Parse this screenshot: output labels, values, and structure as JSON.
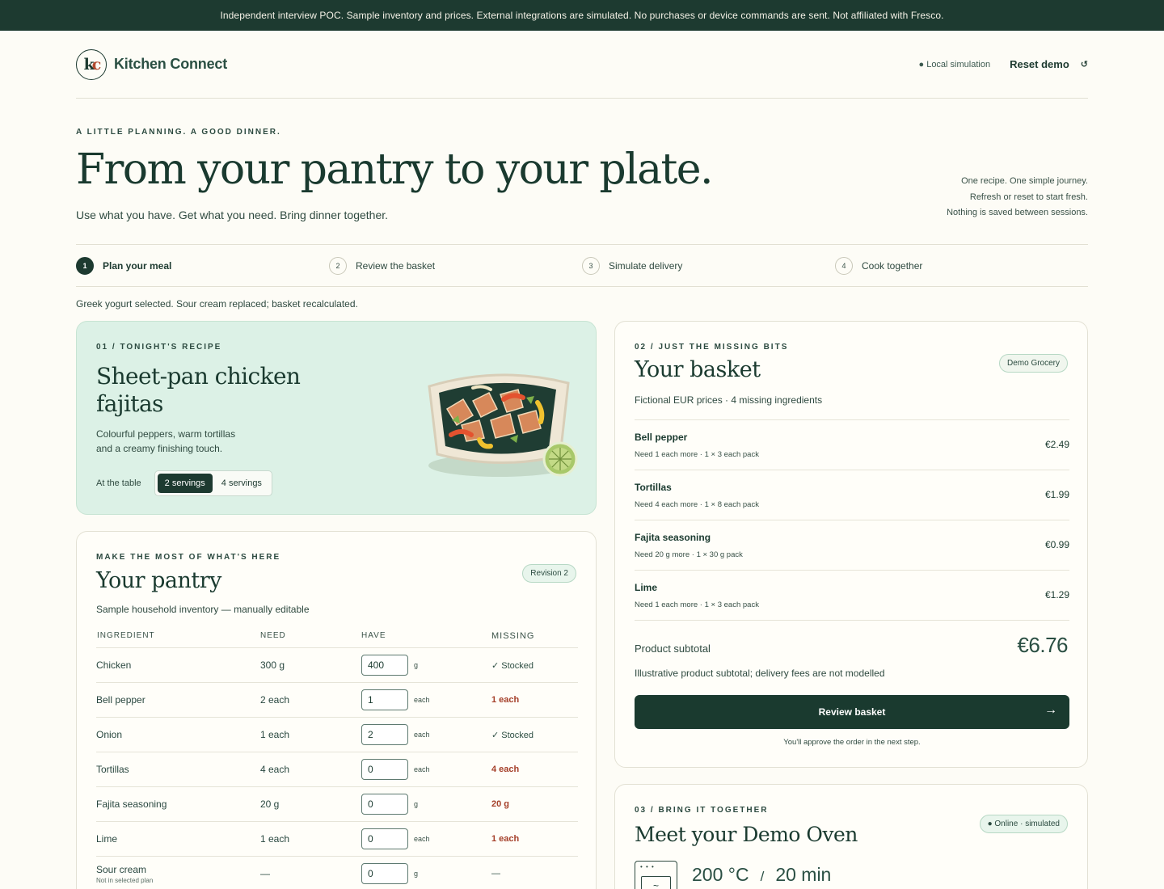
{
  "banner": "Independent interview POC. Sample inventory and prices. External integrations are simulated. No purchases or device commands are sent. Not affiliated with Fresco.",
  "header": {
    "brand": "Kitchen Connect",
    "local_sim": "● Local simulation",
    "reset_label": "Reset demo",
    "reset_icon": "↺"
  },
  "hero": {
    "eyebrow": "A LITTLE PLANNING. A GOOD DINNER.",
    "title": "From your pantry to your plate.",
    "subtitle": "Use what you have. Get what you need. Bring dinner together.",
    "notes": [
      "One recipe. One simple journey.",
      "Refresh or reset to start fresh.",
      "Nothing is saved between sessions."
    ]
  },
  "steps": [
    {
      "num": "1",
      "label": "Plan your meal",
      "active": true
    },
    {
      "num": "2",
      "label": "Review the basket",
      "active": false
    },
    {
      "num": "3",
      "label": "Simulate delivery",
      "active": false
    },
    {
      "num": "4",
      "label": "Cook together",
      "active": false
    }
  ],
  "status": "Greek yogurt selected. Sour cream replaced; basket recalculated.",
  "recipe": {
    "eyebrow": "01 / TONIGHT'S RECIPE",
    "title": "Sheet-pan chicken fajitas",
    "description": "Colourful peppers, warm tortillas and a creamy finishing touch.",
    "table_label": "At the table",
    "servings": [
      "2 servings",
      "4 servings"
    ],
    "selected_serving": "2 servings"
  },
  "pantry": {
    "eyebrow": "MAKE THE MOST OF WHAT'S HERE",
    "title": "Your pantry",
    "subtitle": "Sample household inventory — manually editable",
    "revision": "Revision 2",
    "columns": [
      "INGREDIENT",
      "NEED",
      "HAVE",
      "MISSING"
    ],
    "rows": [
      {
        "ingredient": "Chicken",
        "need": "300 g",
        "have": "400",
        "unit": "g",
        "missing": "✓ Stocked",
        "status": "stocked"
      },
      {
        "ingredient": "Bell pepper",
        "need": "2 each",
        "have": "1",
        "unit": "each",
        "missing": "1 each",
        "status": "missing"
      },
      {
        "ingredient": "Onion",
        "need": "1 each",
        "have": "2",
        "unit": "each",
        "missing": "✓ Stocked",
        "status": "stocked"
      },
      {
        "ingredient": "Tortillas",
        "need": "4 each",
        "have": "0",
        "unit": "each",
        "missing": "4 each",
        "status": "missing"
      },
      {
        "ingredient": "Fajita seasoning",
        "need": "20 g",
        "have": "0",
        "unit": "g",
        "missing": "20 g",
        "status": "missing"
      },
      {
        "ingredient": "Lime",
        "need": "1 each",
        "have": "0",
        "unit": "each",
        "missing": "1 each",
        "status": "missing"
      },
      {
        "ingredient": "Sour cream",
        "note": "Not in selected plan",
        "need": "—",
        "have": "0",
        "unit": "g",
        "missing": "—",
        "status": "none"
      }
    ]
  },
  "basket": {
    "eyebrow": "02 / JUST THE MISSING BITS",
    "title": "Your basket",
    "subtitle": "Fictional EUR prices · 4 missing ingredients",
    "store": "Demo Grocery",
    "items": [
      {
        "name": "Bell pepper",
        "detail": "Need 1 each more · 1 × 3 each pack",
        "price": "€2.49"
      },
      {
        "name": "Tortillas",
        "detail": "Need 4 each more · 1 × 8 each pack",
        "price": "€1.99"
      },
      {
        "name": "Fajita seasoning",
        "detail": "Need 20 g more · 1 × 30 g pack",
        "price": "€0.99"
      },
      {
        "name": "Lime",
        "detail": "Need 1 each more · 1 × 3 each pack",
        "price": "€1.29"
      }
    ],
    "subtotal_label": "Product subtotal",
    "subtotal_value": "€6.76",
    "subtotal_note": "Illustrative product subtotal; delivery fees are not modelled",
    "review_label": "Review basket",
    "review_arrow": "→",
    "approve_note": "You'll approve the order in the next step."
  },
  "oven": {
    "eyebrow": "03 / BRING IT TOGETHER",
    "title": "Meet your Demo Oven",
    "status": "● Online · simulated",
    "temperature": "200 °C",
    "separator": "/",
    "time": "20 min",
    "icon_dots": "• • •",
    "icon_wave": "~"
  },
  "colors": {
    "brand_dark": "#1d3a30",
    "accent_red": "#a5402a",
    "recipe_bg": "#dcf1e6",
    "page_bg": "#fdfcf6"
  }
}
